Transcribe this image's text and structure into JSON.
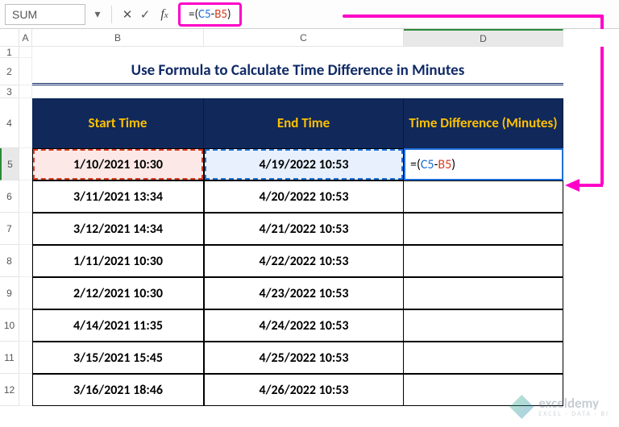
{
  "name_box": "SUM",
  "formula_display": {
    "prefix": "=(",
    "ref1": "C5",
    "op": "-",
    "ref2": "B5",
    "suffix": ")"
  },
  "title": "Use Formula to Calculate Time Difference in Minutes",
  "headers": {
    "b": "Start Time",
    "c": "End Time",
    "d": "Time Difference (Minutes)"
  },
  "col_letters": {
    "a": "A",
    "b": "B",
    "c": "C",
    "d": "D"
  },
  "row_nums": [
    "1",
    "2",
    "3",
    "4",
    "5",
    "6",
    "7",
    "8",
    "9",
    "10",
    "11",
    "12"
  ],
  "rows": [
    {
      "b": "1/10/2021 10:30",
      "c": "4/19/2022 10:53",
      "d": {
        "eq": "=(",
        "c5": "C5",
        "op": "-",
        "b5": "B5",
        "suf": ")"
      }
    },
    {
      "b": "3/11/2021 13:34",
      "c": "4/20/2022 10:53",
      "d": ""
    },
    {
      "b": "3/12/2021 14:34",
      "c": "4/21/2022 10:53",
      "d": ""
    },
    {
      "b": "1/11/2021 10:30",
      "c": "4/22/2022 10:53",
      "d": ""
    },
    {
      "b": "2/12/2021 10:30",
      "c": "4/23/2022 10:53",
      "d": ""
    },
    {
      "b": "4/14/2021 11:35",
      "c": "4/24/2022 10:53",
      "d": ""
    },
    {
      "b": "3/15/2021 15:45",
      "c": "4/25/2022 10:53",
      "d": ""
    },
    {
      "b": "3/16/2021 18:46",
      "c": "4/26/2022 10:53",
      "d": ""
    }
  ],
  "watermark": {
    "brand": "exceldemy",
    "sub": "EXCEL · DATA · BI"
  }
}
